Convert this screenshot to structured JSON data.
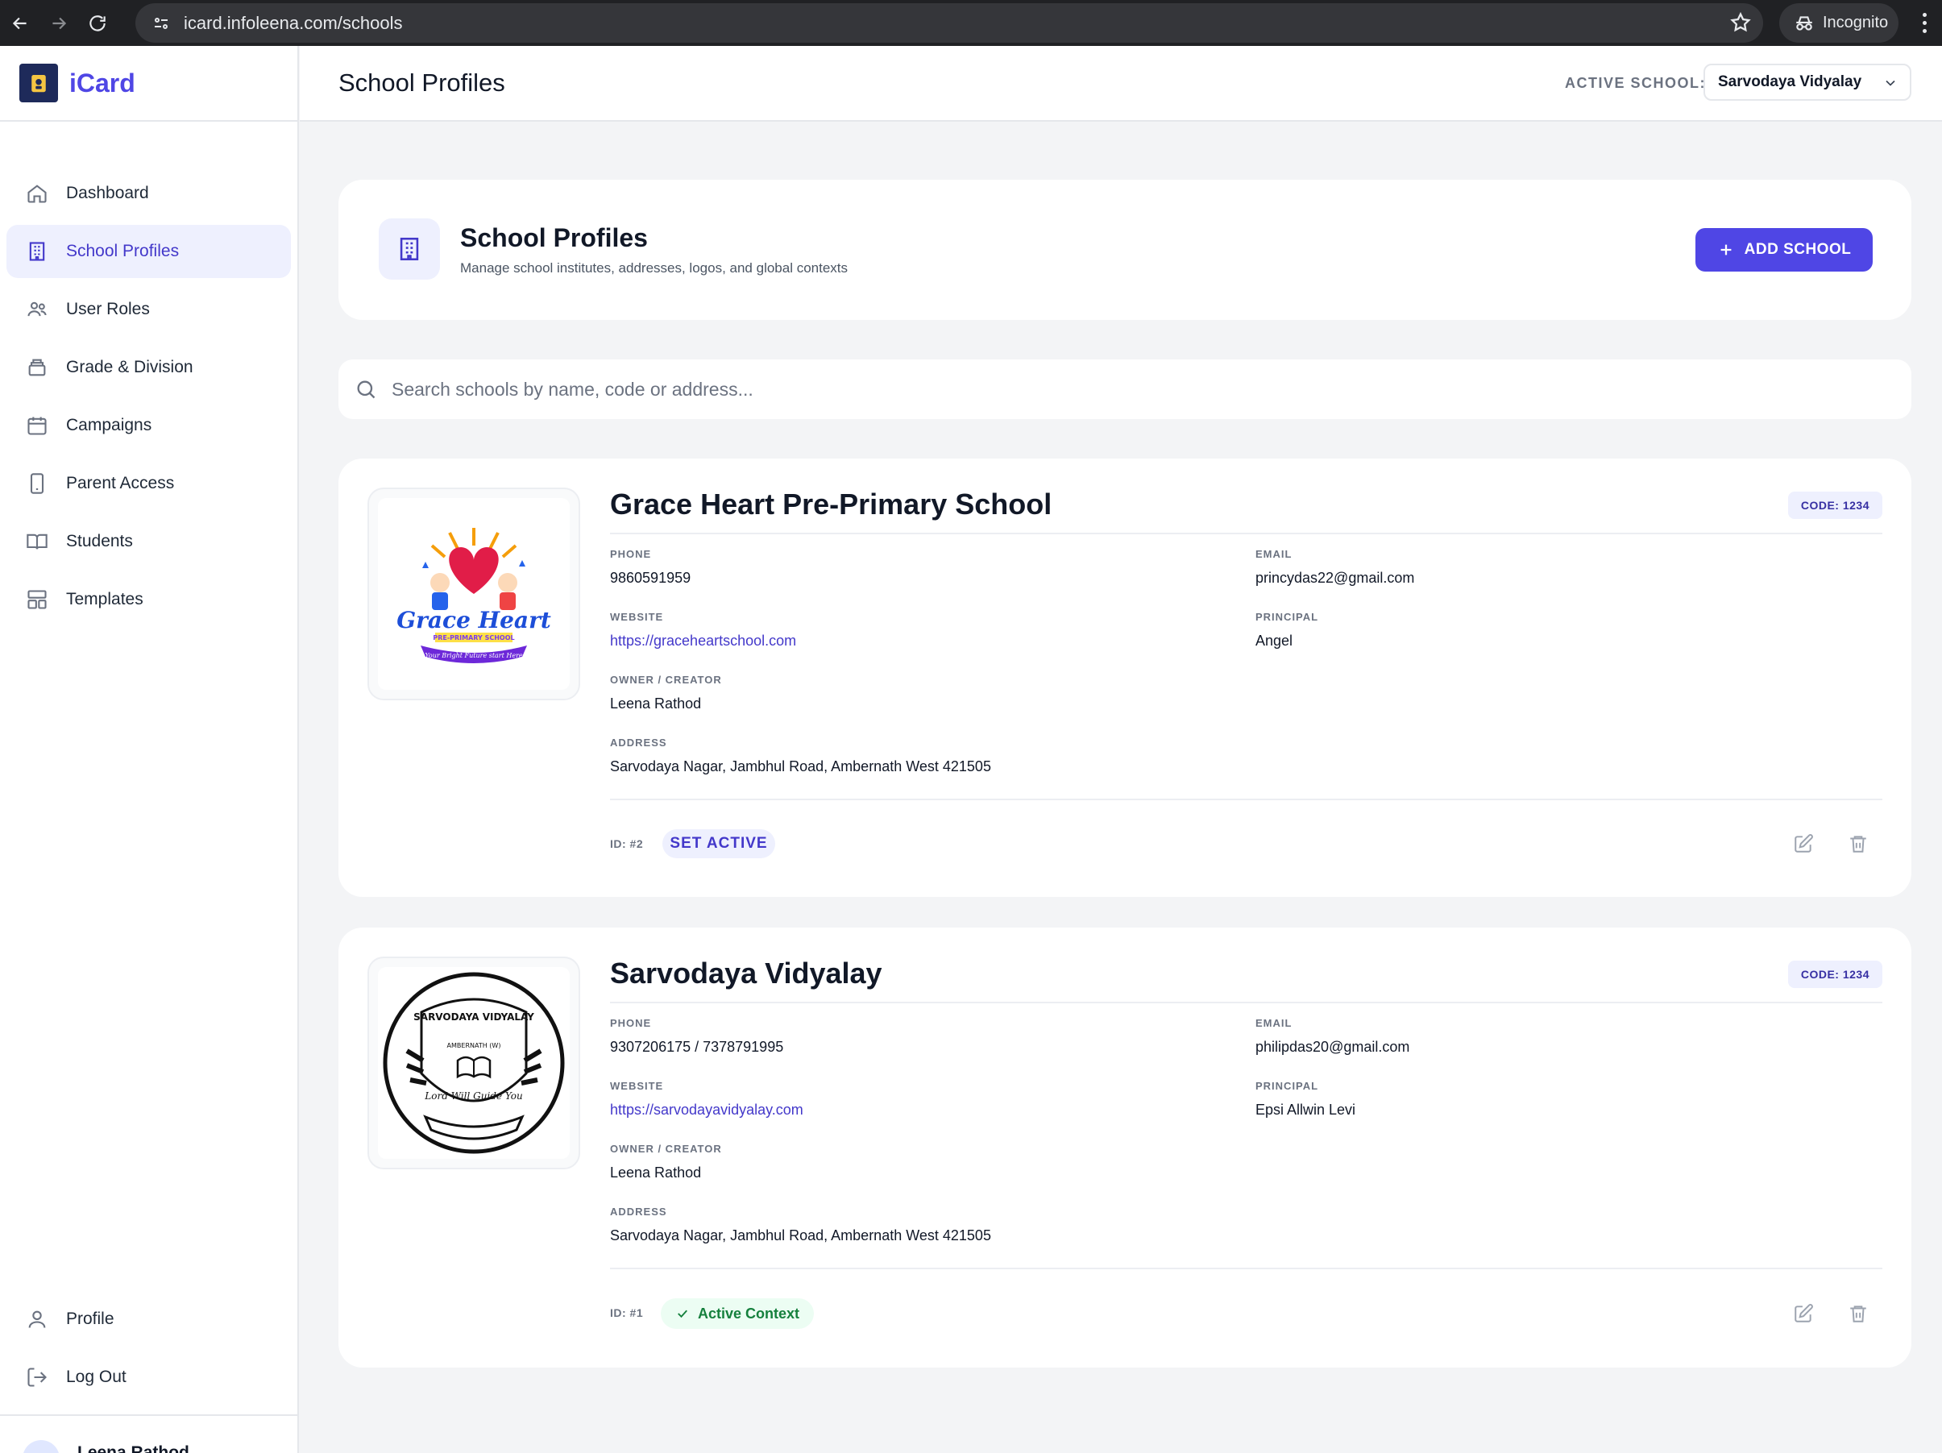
{
  "browser": {
    "url": "icard.infoleena.com/schools",
    "incognito_label": "Incognito"
  },
  "sidebar": {
    "brand": "iCard",
    "items": [
      {
        "label": "Dashboard",
        "icon": "home-icon"
      },
      {
        "label": "School Profiles",
        "icon": "building-icon",
        "active": true
      },
      {
        "label": "User Roles",
        "icon": "users-icon"
      },
      {
        "label": "Grade & Division",
        "icon": "layers-icon"
      },
      {
        "label": "Campaigns",
        "icon": "calendar-icon"
      },
      {
        "label": "Parent Access",
        "icon": "smartphone-icon"
      },
      {
        "label": "Students",
        "icon": "book-icon"
      },
      {
        "label": "Templates",
        "icon": "layout-icon"
      }
    ],
    "bottom_items": [
      {
        "label": "Profile",
        "icon": "user-icon"
      },
      {
        "label": "Log Out",
        "icon": "logout-icon"
      }
    ],
    "user_name": "Leena Rathod"
  },
  "header": {
    "title": "School Profiles",
    "active_school_label": "ACTIVE SCHOOL:",
    "active_school_value": "Sarvodaya Vidyalay"
  },
  "hero": {
    "title": "School Profiles",
    "subtitle": "Manage school institutes, addresses, logos, and global contexts",
    "add_button": "ADD SCHOOL"
  },
  "search": {
    "placeholder": "Search schools by name, code or address..."
  },
  "labels": {
    "phone": "PHONE",
    "email": "EMAIL",
    "website": "WEBSITE",
    "principal": "PRINCIPAL",
    "owner": "OWNER / CREATOR",
    "address": "ADDRESS"
  },
  "schools": [
    {
      "name": "Grace Heart Pre-Primary School",
      "code": "CODE: 1234",
      "phone": "9860591959",
      "email": "princydas22@gmail.com",
      "website": "https://graceheartschool.com",
      "principal": "Angel",
      "owner": "Leena Rathod",
      "address": "Sarvodaya Nagar, Jambhul Road, Ambernath West 421505",
      "id": "ID: #2",
      "action": "SET ACTIVE",
      "logo_text": {
        "line1": "Grace Heart",
        "line2": "PRE-PRIMARY SCHOOL",
        "line3": "Your Bright Future start Here"
      }
    },
    {
      "name": "Sarvodaya Vidyalay",
      "code": "CODE: 1234",
      "phone": "9307206175 / 7378791995",
      "email": "philipdas20@gmail.com",
      "website": "https://sarvodayavidyalay.com",
      "principal": "Epsi Allwin Levi",
      "owner": "Leena Rathod",
      "address": "Sarvodaya Nagar, Jambhul Road, Ambernath West 421505",
      "id": "ID: #1",
      "action": "Active Context",
      "logo_text": {
        "line1": "SARVODAYA VIDYALAY",
        "line2": "AMBERNATH (W)",
        "line3": "Lord Will Guide You"
      }
    }
  ]
}
